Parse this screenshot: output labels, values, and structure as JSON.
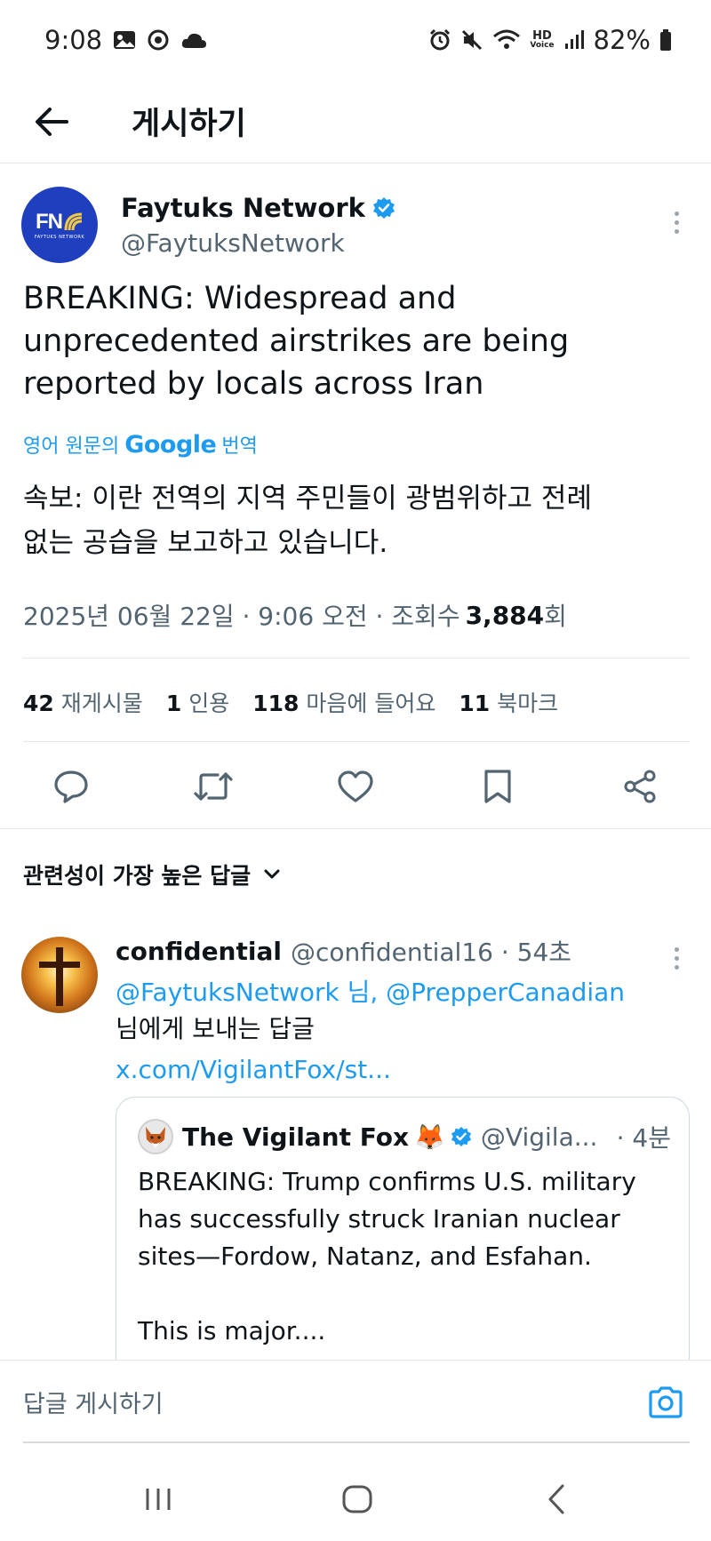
{
  "status_bar": {
    "time": "9:08",
    "hd_label": "HD",
    "voice_label": "Voice",
    "battery": "82%"
  },
  "top_bar": {
    "title": "게시하기"
  },
  "post": {
    "author_name": "Faytuks Network",
    "author_handle": "@FaytuksNetwork",
    "avatar_text": "FN",
    "avatar_subtext": "FAYTUKS NETWORK",
    "text": "BREAKING: Widespread and\nunprecedented airstrikes are being\nreported by locals across Iran",
    "translate_prefix": "영어 원문의",
    "translate_brand": "Google",
    "translate_suffix": "번역",
    "translated_text": "속보: 이란 전역의 지역 주민들이 광범위하고 전례\n없는 공습을 보고하고 있습니다.",
    "timestamp": "2025년 06월 22일 · 9:06 오전 · 조회수",
    "views_count": "3,884",
    "views_suffix": "회",
    "stats": [
      {
        "count": "42",
        "label": "재게시물"
      },
      {
        "count": "1",
        "label": "인용"
      },
      {
        "count": "118",
        "label": "마음에 들어요"
      },
      {
        "count": "11",
        "label": "북마크"
      }
    ]
  },
  "replies_section": {
    "sort_label": "관련성이 가장 높은 답글"
  },
  "reply": {
    "name": "confidential",
    "handle_time": "@confidential16 · 54초",
    "mentions": "@FaytuksNetwork 님, @PrepperCanadian",
    "mention_suffix": "님에게 보내는 답글",
    "link": "x.com/VigilantFox/st...",
    "quote": {
      "name": "The Vigilant Fox",
      "emoji": "🦊",
      "handle": "@Vigila...",
      "time": "· 4분",
      "text": "BREAKING: Trump confirms U.S. military\nhas successfully struck Iranian nuclear\nsites—Fordow, Natanz, and Esfahan.\n\nThis is major...."
    }
  },
  "compose": {
    "placeholder": "답글 게시하기"
  },
  "colors": {
    "accent": "#1d9bf0",
    "text": "#0f1419",
    "muted": "#536471",
    "avatar_blue": "#1f3fbf"
  }
}
